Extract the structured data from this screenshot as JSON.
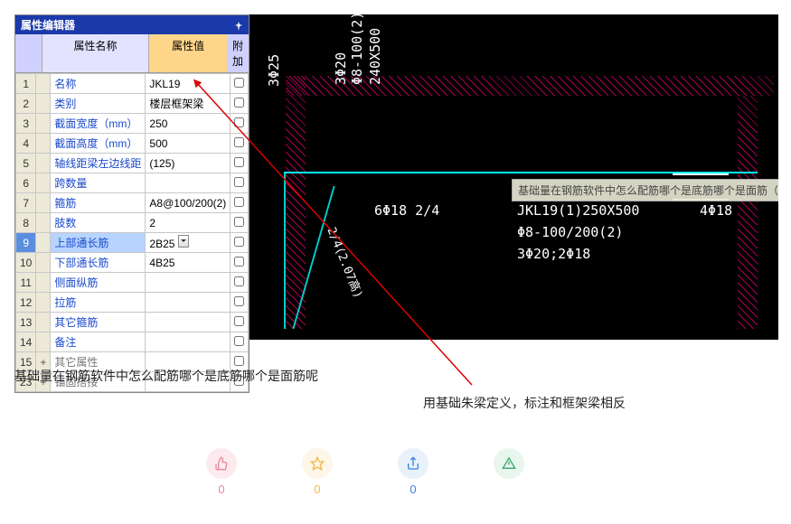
{
  "panel": {
    "title": "属性编辑器",
    "header": {
      "col_name": "属性名称",
      "col_value": "属性值",
      "col_attach": "附加"
    }
  },
  "rows": [
    {
      "n": "1",
      "name": "名称",
      "val": "JKL19"
    },
    {
      "n": "2",
      "name": "类别",
      "val": "楼层框架梁"
    },
    {
      "n": "3",
      "name": "截面宽度（mm）",
      "val": "250"
    },
    {
      "n": "4",
      "name": "截面高度（mm）",
      "val": "500"
    },
    {
      "n": "5",
      "name": "轴线距梁左边线距",
      "val": "(125)"
    },
    {
      "n": "6",
      "name": "跨数量",
      "val": ""
    },
    {
      "n": "7",
      "name": "箍筋",
      "val": "A8@100/200(2)"
    },
    {
      "n": "8",
      "name": "肢数",
      "val": "2"
    },
    {
      "n": "9",
      "name": "上部通长筋",
      "val": "2B25",
      "sel": true,
      "dd": true
    },
    {
      "n": "10",
      "name": "下部通长筋",
      "val": "4B25"
    },
    {
      "n": "11",
      "name": "侧面纵筋",
      "val": ""
    },
    {
      "n": "12",
      "name": "拉筋",
      "val": ""
    },
    {
      "n": "13",
      "name": "其它箍筋",
      "val": ""
    },
    {
      "n": "14",
      "name": "备注",
      "val": ""
    },
    {
      "n": "15",
      "name": "其它属性",
      "val": "",
      "gray": true,
      "exp": "+"
    },
    {
      "n": "23",
      "name": "锚固搭接",
      "val": "",
      "gray": true,
      "exp": "+"
    }
  ],
  "cad": {
    "t1": "3Φ25",
    "t2": "3Φ20",
    "t3": "Φ8-100(2)",
    "t4": "240X500",
    "t5": "6Φ18 2/4",
    "t6": "2/4(2.07高)",
    "t7": "JKL19(1)250X500",
    "t8": "Φ8-100/200(2)",
    "t9": "3Φ20;2Φ18",
    "t10": "4Φ18",
    "tooltip": "基础量在钢筋软件中怎么配筋哪个是底筋哪个是面筋（详细"
  },
  "q1": "基础量在钢筋软件中怎么配筋哪个是底筋哪个是面筋呢",
  "q2": "用基础朱梁定义，标注和框架梁相反",
  "reactions": {
    "like": {
      "count": "0",
      "color": "#e9889b",
      "bg": "#fdeaee"
    },
    "star": {
      "count": "0",
      "color": "#f0b74a",
      "bg": "#fef6e8"
    },
    "share": {
      "count": "0",
      "color": "#3b83d8",
      "bg": "#e9f1fb"
    },
    "report": {
      "count": "",
      "color": "#39a76b",
      "bg": "#e8f6ee"
    }
  }
}
